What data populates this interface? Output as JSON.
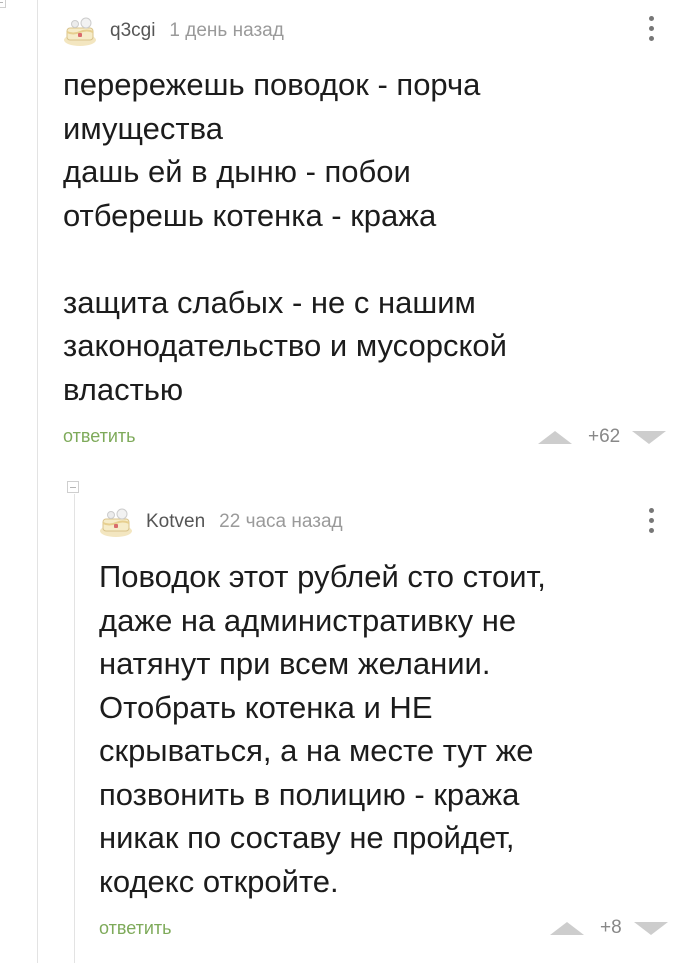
{
  "comments": [
    {
      "username": "q3cgi",
      "timestamp": "1 день назад",
      "text": "перережешь поводок - порча\nимущества\nдашь ей в дыню - побои\nотберешь котенка - кража\n\nзащита слабых - не с нашим\nзаконодательство и мусорской\nвластью",
      "reply_label": "ответить",
      "rating": "+62"
    },
    {
      "username": "Kotven",
      "timestamp": "22 часа назад",
      "text": "Поводок этот рублей сто стоит,\nдаже на административку не\nнатянут при всем желании.\nОтобрать котенка и НЕ\nскрываться, а на месте тут же\nпозвонить в полицию - кража\nникак по составу не пройдет,\nкодекс откройте.",
      "reply_label": "ответить",
      "rating": "+8"
    }
  ],
  "colors": {
    "reply_link": "#7eaa5a",
    "thread_line": "#e3e3e3",
    "vote_arrow": "#cdcdcd"
  },
  "icons": [
    "cake-avatar-icon",
    "more-vertical-icon",
    "collapse-icon",
    "upvote-icon",
    "downvote-icon"
  ]
}
